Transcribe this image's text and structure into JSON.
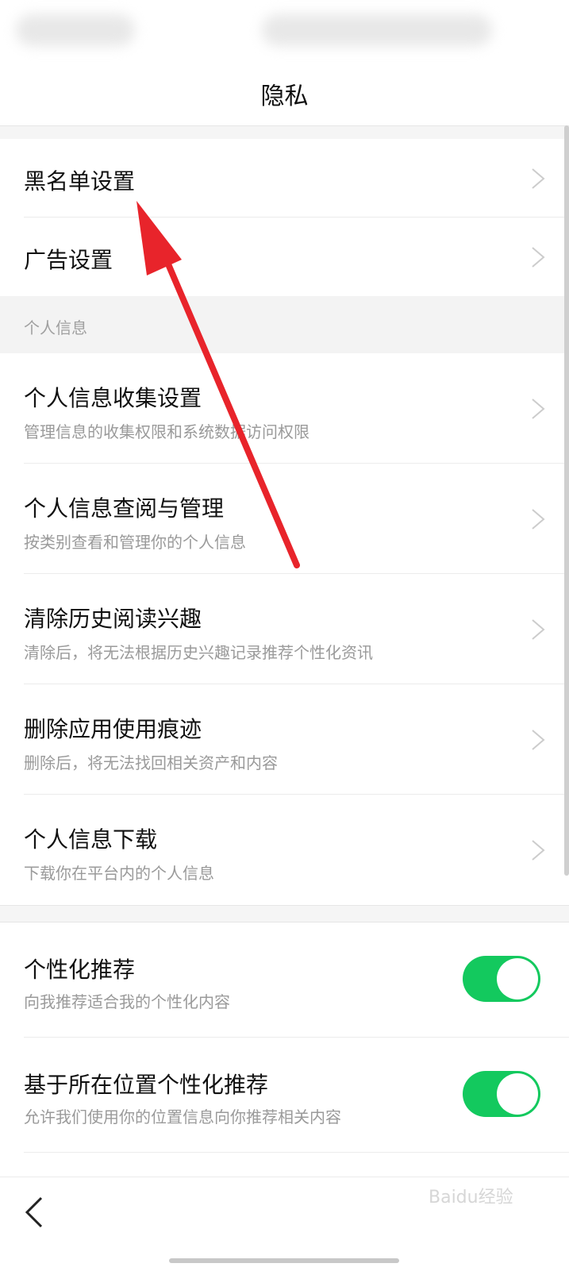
{
  "header": {
    "title": "隐私"
  },
  "top_items": [
    {
      "label": "黑名单设置"
    },
    {
      "label": "广告设置"
    }
  ],
  "section": {
    "label": "个人信息"
  },
  "info_items": [
    {
      "label": "个人信息收集设置",
      "description": "管理信息的收集权限和系统数据访问权限"
    },
    {
      "label": "个人信息查阅与管理",
      "description": "按类别查看和管理你的个人信息"
    },
    {
      "label": "清除历史阅读兴趣",
      "description": "清除后，将无法根据历史兴趣记录推荐个性化资讯"
    },
    {
      "label": "删除应用使用痕迹",
      "description": "删除后，将无法找回相关资产和内容"
    },
    {
      "label": "个人信息下载",
      "description": "下载你在平台内的个人信息"
    }
  ],
  "toggle_items": [
    {
      "label": "个性化推荐",
      "description": "向我推荐适合我的个性化内容",
      "enabled": true
    },
    {
      "label": "基于所在位置个性化推荐",
      "description": "允许我们使用你的位置信息向你推荐相关内容",
      "enabled": true
    }
  ],
  "watermark": "Baidu经验",
  "colors": {
    "toggle_on": "#13c95e",
    "annotation_arrow": "#e8242b"
  }
}
